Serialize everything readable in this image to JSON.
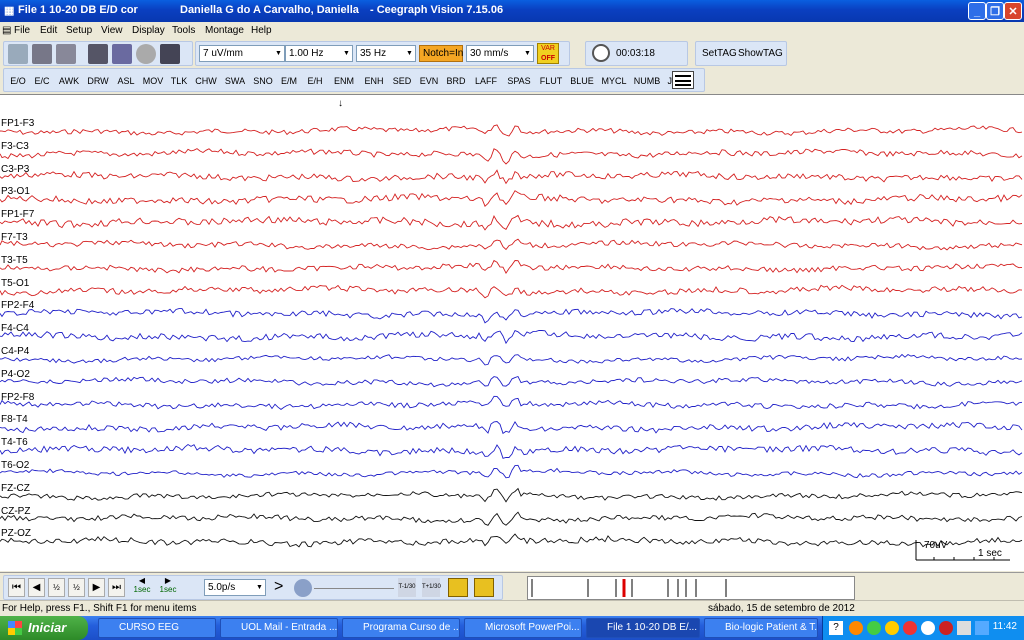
{
  "window": {
    "title_file": "File 1   10-20 DB E/D cor",
    "title_patient": "Daniella G do A Carvalho, Daniella",
    "title_app": "- Ceegraph Vision  7.15.06"
  },
  "menu": [
    "File",
    "Edit",
    "Setup",
    "View",
    "Display",
    "Tools",
    "Montage",
    "Help"
  ],
  "toolbar": {
    "sensitivity": "7 uV/mm",
    "low_filter": "1.00 Hz",
    "high_filter": "35 Hz",
    "notch": "Notch=In",
    "speed": "30 mm/s",
    "var_label": "VAR",
    "var_state": "OFF",
    "timer": "00:03:18",
    "settag": "SetTAG",
    "showtag": "ShowTAG"
  },
  "event_tags": [
    "E/O",
    "E/C",
    "AWK",
    "DRW",
    "ASL",
    "MOV",
    "TLK",
    "CHW",
    "SWA",
    "SNO",
    "E/M",
    "E/H",
    "ENM",
    "ENH",
    "SED",
    "EVN",
    "BRD",
    "LAFF",
    "SPAS",
    "FLUT",
    "BLUE",
    "MYCL",
    "NUMB",
    "JERK"
  ],
  "channels": [
    {
      "label": "FP1-F3",
      "color": "#d42020"
    },
    {
      "label": "F3-C3",
      "color": "#d42020"
    },
    {
      "label": "C3-P3",
      "color": "#d42020"
    },
    {
      "label": "P3-O1",
      "color": "#d42020"
    },
    {
      "label": "FP1-F7",
      "color": "#d42020"
    },
    {
      "label": "F7-T3",
      "color": "#d42020"
    },
    {
      "label": "T3-T5",
      "color": "#d42020"
    },
    {
      "label": "T5-O1",
      "color": "#d42020"
    },
    {
      "label": "FP2-F4",
      "color": "#2020c8"
    },
    {
      "label": "F4-C4",
      "color": "#2020c8"
    },
    {
      "label": "C4-P4",
      "color": "#2020c8"
    },
    {
      "label": "P4-O2",
      "color": "#2020c8"
    },
    {
      "label": "FP2-F8",
      "color": "#2020c8"
    },
    {
      "label": "F8-T4",
      "color": "#2020c8"
    },
    {
      "label": "T4-T6",
      "color": "#2020c8"
    },
    {
      "label": "T6-O2",
      "color": "#2020c8"
    },
    {
      "label": "FZ-CZ",
      "color": "#111111"
    },
    {
      "label": "CZ-PZ",
      "color": "#111111"
    },
    {
      "label": "PZ-OZ",
      "color": "#111111"
    }
  ],
  "scale": {
    "amplitude": "70uV",
    "time": "1 sec"
  },
  "playback": {
    "step_left": "1sec",
    "step_right": "1sec",
    "speed": "5.0p/s",
    "slow1": "T-1/30",
    "slow2": "T+1/30"
  },
  "status": {
    "help": "For Help, press F1., Shift F1 for menu items",
    "date": "sábado, 15 de setembro de 2012"
  },
  "taskbar": {
    "start": "Iniciar",
    "tasks": [
      "CURSO EEG",
      "UOL Mail - Entrada ...",
      "Programa Curso de ...",
      "Microsoft PowerPoi...",
      "File 1   10-20 DB E/...",
      "Bio-logic Patient & T..."
    ],
    "clock": "11:42"
  }
}
